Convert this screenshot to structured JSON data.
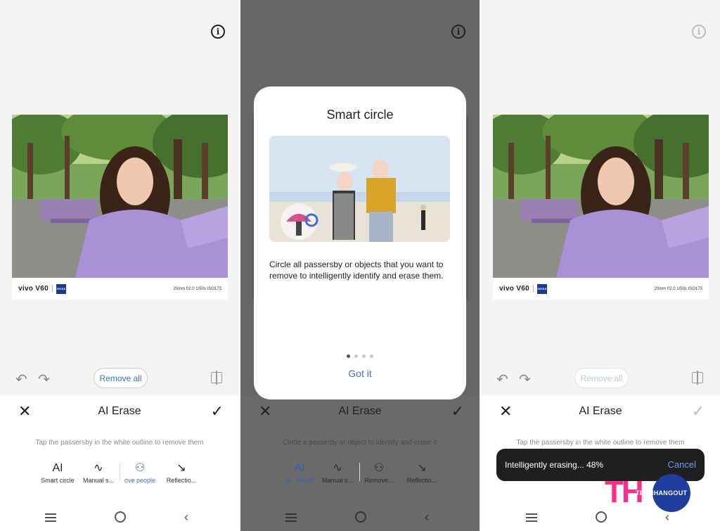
{
  "colors": {
    "accent": "#3b6fd8",
    "overlay": "#666666",
    "toast_bg": "#1f1f1f",
    "logo_pink": "#ff2d8a",
    "logo_blue": "#1e3d9e"
  },
  "icons": {
    "info": "i",
    "undo": "↶",
    "redo": "↷",
    "close": "✕",
    "confirm": "✓",
    "nav_back": "‹"
  },
  "watermark": {
    "brand": "vivo V60",
    "separator": "|",
    "zeiss": "ZEISS",
    "specs": "20mm  f/2.0  1/50s  ISO173"
  },
  "panel1": {
    "remove_all": "Remove all",
    "title": "AI Erase",
    "hint": "Tap the passersby in the white outline to remove them",
    "tools": [
      {
        "icon": "AI",
        "label": "Smart circle"
      },
      {
        "icon": "∿",
        "label": "Manual s..."
      },
      {
        "icon": "⚇",
        "label": "ove people"
      },
      {
        "icon": "↘",
        "label": "Reflectio..."
      }
    ]
  },
  "panel2": {
    "title": "AI Erase",
    "hint": "Circle a passerby or object to identify and erase it",
    "tools": [
      {
        "icon": "AI",
        "label": "Smart",
        "prefix": "le"
      },
      {
        "icon": "∿",
        "label": "Manual s..."
      },
      {
        "icon": "⚇",
        "label": "Remove..."
      },
      {
        "icon": "↘",
        "label": "Reflectio..."
      }
    ],
    "dialog": {
      "title": "Smart circle",
      "description": "Circle all passersby or objects that you want to remove to intelligently identify and erase them.",
      "page_count": 4,
      "active_page": 1,
      "button": "Got it"
    }
  },
  "panel3": {
    "remove_all": "Remove all",
    "title": "AI Erase",
    "hint": "Tap the passersby in the white outline to remove them",
    "toast": {
      "message": "Intelligently erasing... 48%",
      "progress_percent": 48,
      "cancel": "Cancel"
    }
  },
  "logo": {
    "letters": "TH",
    "wordmark": "TECHHANGOUT"
  }
}
